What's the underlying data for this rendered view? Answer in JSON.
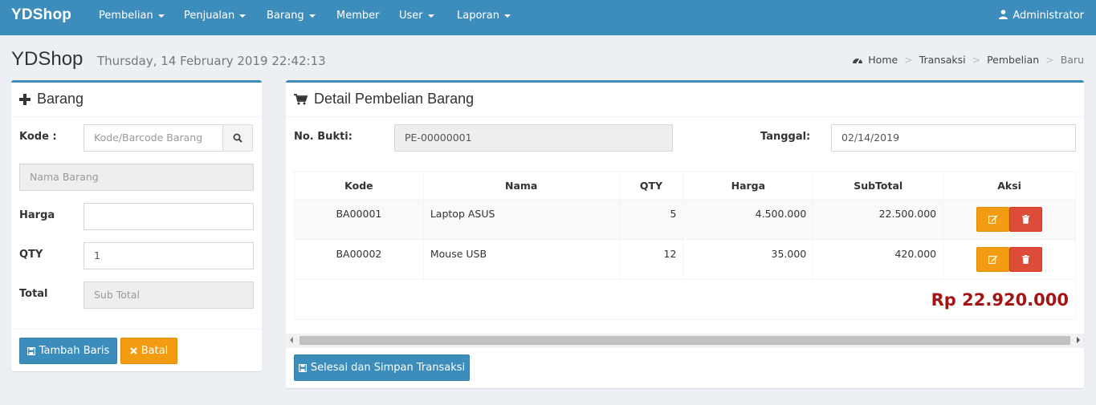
{
  "navbar": {
    "brand": "YDShop",
    "items": [
      "Pembelian",
      "Penjualan",
      "Barang",
      "Member",
      "User",
      "Laporan"
    ],
    "user": "Administrator"
  },
  "header": {
    "title": "YDShop",
    "datetime": "Thursday, 14 February 2019 22:42:13",
    "breadcrumb": [
      "Home",
      "Transaksi",
      "Pembelian",
      "Baru"
    ]
  },
  "left": {
    "title": "Barang",
    "kode_label": "Kode :",
    "kode_placeholder": "Kode/Barcode Barang",
    "nama_placeholder": "Nama Barang",
    "harga_label": "Harga",
    "harga_value": "",
    "qty_label": "QTY",
    "qty_value": "1",
    "total_label": "Total",
    "total_placeholder": "Sub Total",
    "add_button": "Tambah Baris",
    "cancel_button": "Batal"
  },
  "right": {
    "title": "Detail Pembelian Barang",
    "no_bukti_label": "No. Bukti:",
    "no_bukti_value": "PE-00000001",
    "tanggal_label": "Tanggal:",
    "tanggal_value": "02/14/2019",
    "columns": [
      "Kode",
      "Nama",
      "QTY",
      "Harga",
      "SubTotal",
      "Aksi"
    ],
    "rows": [
      {
        "kode": "BA00001",
        "nama": "Laptop ASUS",
        "qty": "5",
        "harga": "4.500.000",
        "subtotal": "22.500.000"
      },
      {
        "kode": "BA00002",
        "nama": "Mouse USB",
        "qty": "12",
        "harga": "35.000",
        "subtotal": "420.000"
      }
    ],
    "grand_total": "Rp 22.920.000",
    "save_button": "Selesai dan Simpan Transaksi"
  },
  "colors": {
    "primary": "#3c8dbc",
    "warning": "#f39c12",
    "danger": "#dd4b39",
    "total": "#a31515"
  },
  "icons": [
    "user-icon",
    "dashboard-icon",
    "plus-icon",
    "search-icon",
    "cart-icon",
    "save-icon",
    "close-icon",
    "edit-icon",
    "trash-icon"
  ]
}
